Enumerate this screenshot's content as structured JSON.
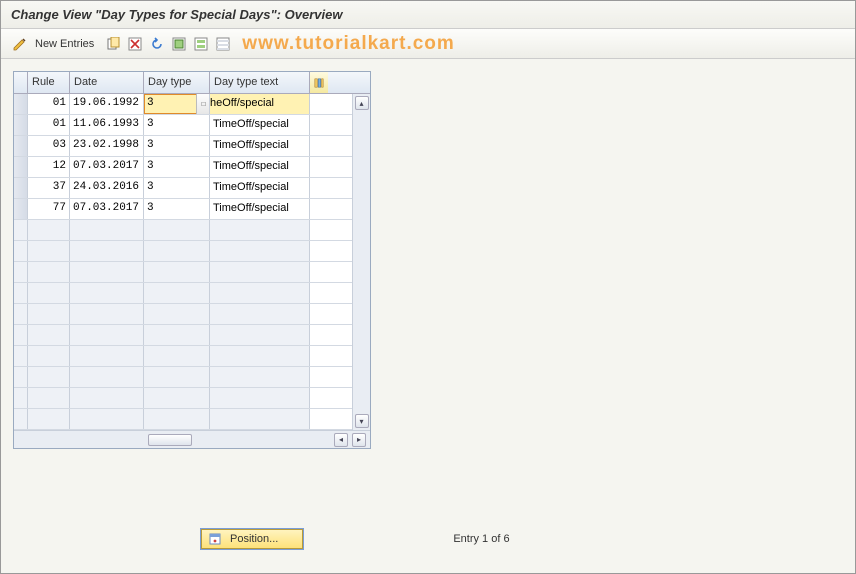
{
  "header": {
    "title": "Change View \"Day Types for Special Days\": Overview"
  },
  "toolbar": {
    "new_entries_label": "New Entries",
    "watermark": "www.tutorialkart.com"
  },
  "grid": {
    "columns": {
      "rule": "Rule",
      "date": "Date",
      "daytype": "Day type",
      "text": "Day type text"
    },
    "rows": [
      {
        "rule": "01",
        "date": "19.06.1992",
        "daytype": "3",
        "text": "heOff/special",
        "active": true
      },
      {
        "rule": "01",
        "date": "11.06.1993",
        "daytype": "3",
        "text": "TimeOff/special",
        "active": false
      },
      {
        "rule": "03",
        "date": "23.02.1998",
        "daytype": "3",
        "text": "TimeOff/special",
        "active": false
      },
      {
        "rule": "12",
        "date": "07.03.2017",
        "daytype": "3",
        "text": "TimeOff/special",
        "active": false
      },
      {
        "rule": "37",
        "date": "24.03.2016",
        "daytype": "3",
        "text": "TimeOff/special",
        "active": false
      },
      {
        "rule": "77",
        "date": "07.03.2017",
        "daytype": "3",
        "text": "TimeOff/special",
        "active": false
      }
    ],
    "empty_row_count": 10
  },
  "footer": {
    "position_label": "Position...",
    "entry_counter": "Entry 1 of 6"
  }
}
